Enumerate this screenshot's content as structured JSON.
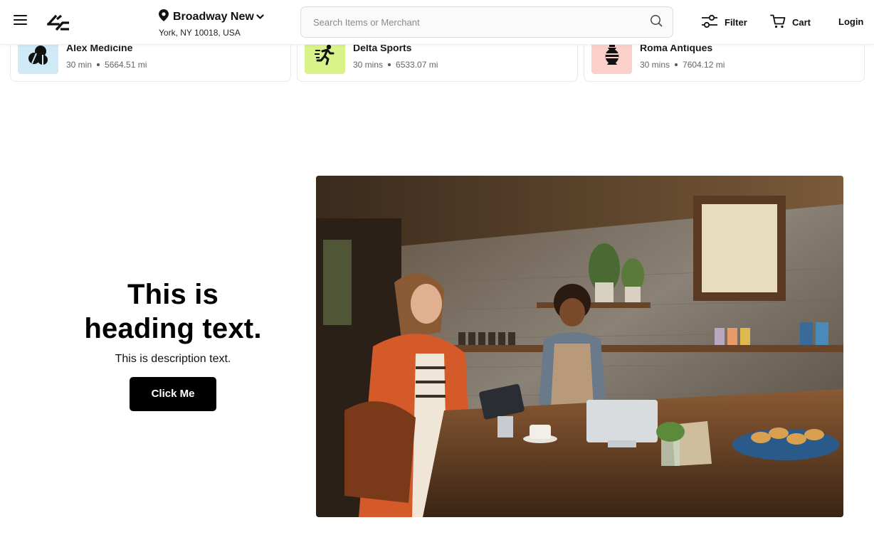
{
  "header": {
    "location": {
      "title": "Broadway New",
      "subtitle": "York, NY 10018, USA"
    },
    "search": {
      "placeholder": "Search Items or Merchant",
      "value": ""
    },
    "filter_label": "Filter",
    "cart_label": "Cart",
    "login_label": "Login"
  },
  "merchants": [
    {
      "name": "Alex Medicine",
      "time": "30 min",
      "distance": "5664.51 mi",
      "icon": "pills-icon",
      "bg": "#cfe9f7"
    },
    {
      "name": "Delta Sports",
      "time": "30 mins",
      "distance": "6533.07 mi",
      "icon": "runner-icon",
      "bg": "#d9f28a"
    },
    {
      "name": "Roma Antiques",
      "time": "30 mins",
      "distance": "7604.12 mi",
      "icon": "vase-icon",
      "bg": "#fbd0c8"
    }
  ],
  "hero": {
    "heading_line1": "This is",
    "heading_line2": "heading text.",
    "description": "This is description text.",
    "button_label": "Click Me"
  },
  "colors": {
    "accent": "#000000",
    "background": "#ffffff"
  }
}
